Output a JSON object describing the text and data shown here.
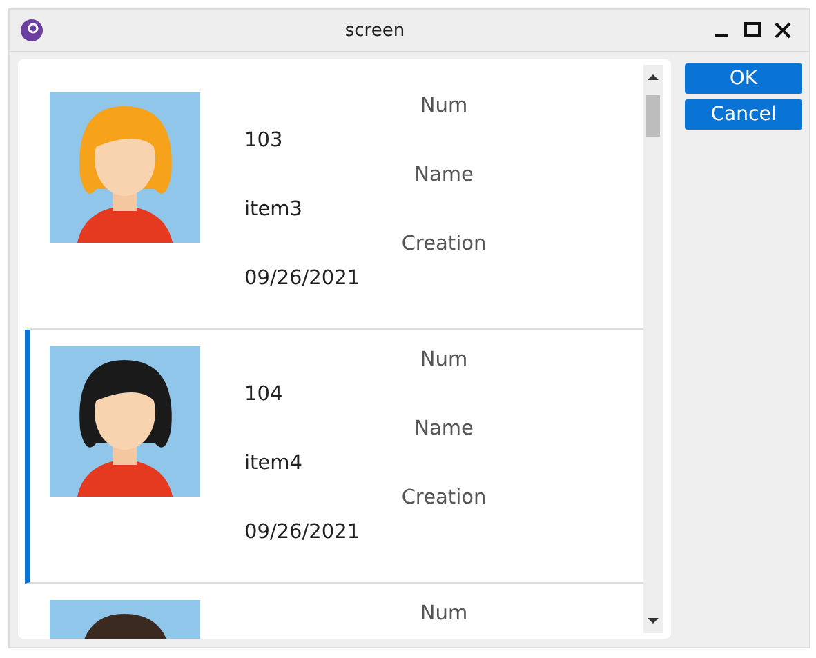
{
  "window": {
    "title": "screen"
  },
  "items": [
    {
      "selected": false,
      "color": "#f7a21b",
      "fields": [
        {
          "label": "Num",
          "value": "103"
        },
        {
          "label": "Name",
          "value": "item3"
        },
        {
          "label": "Creation",
          "value": "09/26/2021"
        }
      ]
    },
    {
      "selected": true,
      "color": "#1a1a1a",
      "fields": [
        {
          "label": "Num",
          "value": "104"
        },
        {
          "label": "Name",
          "value": "item4"
        },
        {
          "label": "Creation",
          "value": "09/26/2021"
        }
      ]
    },
    {
      "selected": false,
      "color": "#3b2a20",
      "fields": [
        {
          "label": "Num"
        }
      ]
    }
  ],
  "buttons": [
    "OK",
    "Cancel"
  ]
}
